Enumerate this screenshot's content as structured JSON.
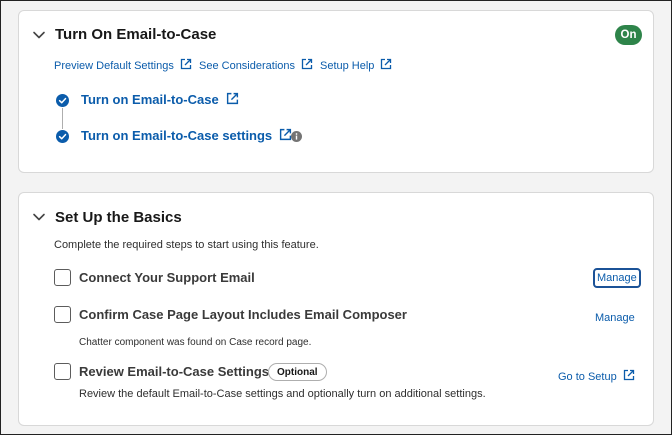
{
  "section1": {
    "title": "Turn On Email-to-Case",
    "status_badge": "On",
    "links": [
      {
        "label": "Preview Default Settings",
        "icon": "external-link-icon"
      },
      {
        "label": "See Considerations",
        "icon": "external-link-icon"
      },
      {
        "label": "Setup Help",
        "icon": "external-link-icon"
      }
    ],
    "steps": [
      {
        "label": "Turn on Email-to-Case",
        "status": "complete"
      },
      {
        "label": "Turn on Email-to-Case settings",
        "status": "complete",
        "has_info": true
      }
    ]
  },
  "section2": {
    "title": "Set Up the Basics",
    "description": "Complete the required steps to start using this feature.",
    "tasks": [
      {
        "label": "Connect Your Support Email",
        "action": "Manage",
        "checked": false
      },
      {
        "label": "Confirm Case Page Layout Includes Email Composer",
        "note": "Chatter component was found on Case record page.",
        "action": "Manage",
        "checked": false
      },
      {
        "label": "Review Email-to-Case Settings",
        "badge": "Optional",
        "note": "Review the default Email-to-Case settings and optionally turn on additional settings.",
        "action": "Go to Setup",
        "checked": false
      }
    ]
  },
  "colors": {
    "link": "#0b5cab",
    "success": "#2e844a",
    "background": "#f3f3f3"
  }
}
